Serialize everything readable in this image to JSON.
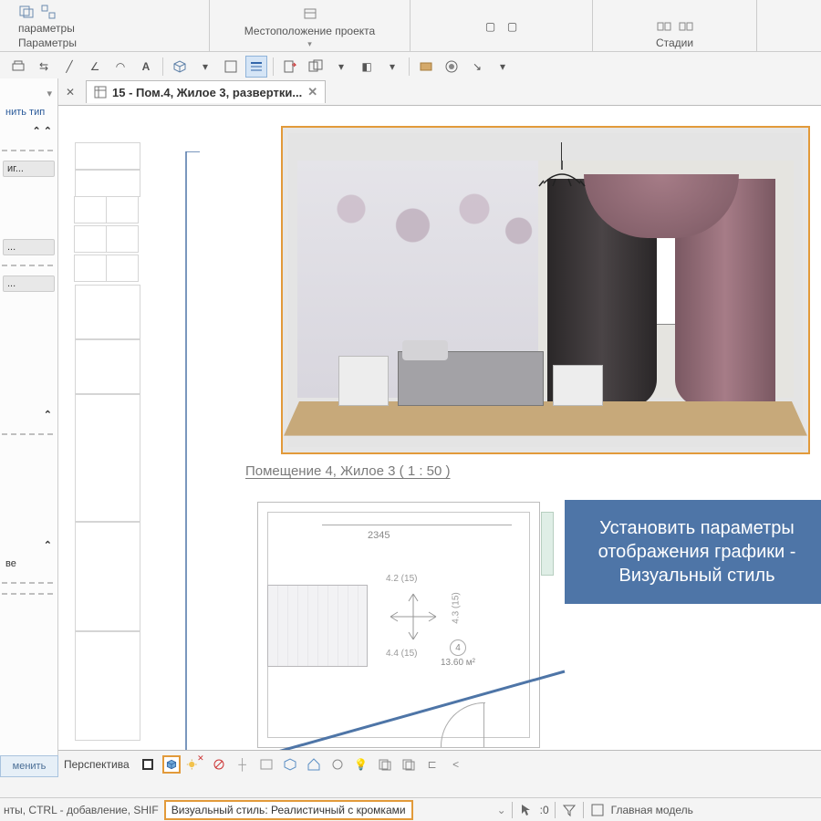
{
  "ribbon": {
    "group1_sub": "параметры",
    "group1_label": "Параметры",
    "group2_label": "Местоположение проекта",
    "group3_label": "Стадии"
  },
  "tab": {
    "title": "15 - Пом.4, Жилое 3, развертки..."
  },
  "left": {
    "edit_type": "нить тип",
    "item_ig": "иг...",
    "item_dots": "...",
    "item_ve": "ве"
  },
  "view": {
    "label": "Помещение 4, Жилое 3 ( 1 : 50 )"
  },
  "plan": {
    "dim_top": "2345",
    "dim_n": "4.2 (15)",
    "dim_e": "4.3 (15)",
    "dim_s": "4.4 (15)",
    "room_num": "4",
    "room_area": "13.60 м²"
  },
  "callout": {
    "text": "Установить параметры отображения графики - Визуальный стиль"
  },
  "viewbar": {
    "perspective": "Перспектива"
  },
  "status": {
    "hint": "нты, CTRL - добавление, SHIF",
    "tooltip": "Визуальный стиль: Реалистичный с кромками",
    "zero": ":0",
    "model": "Главная модель"
  },
  "btn_apply": "менить"
}
